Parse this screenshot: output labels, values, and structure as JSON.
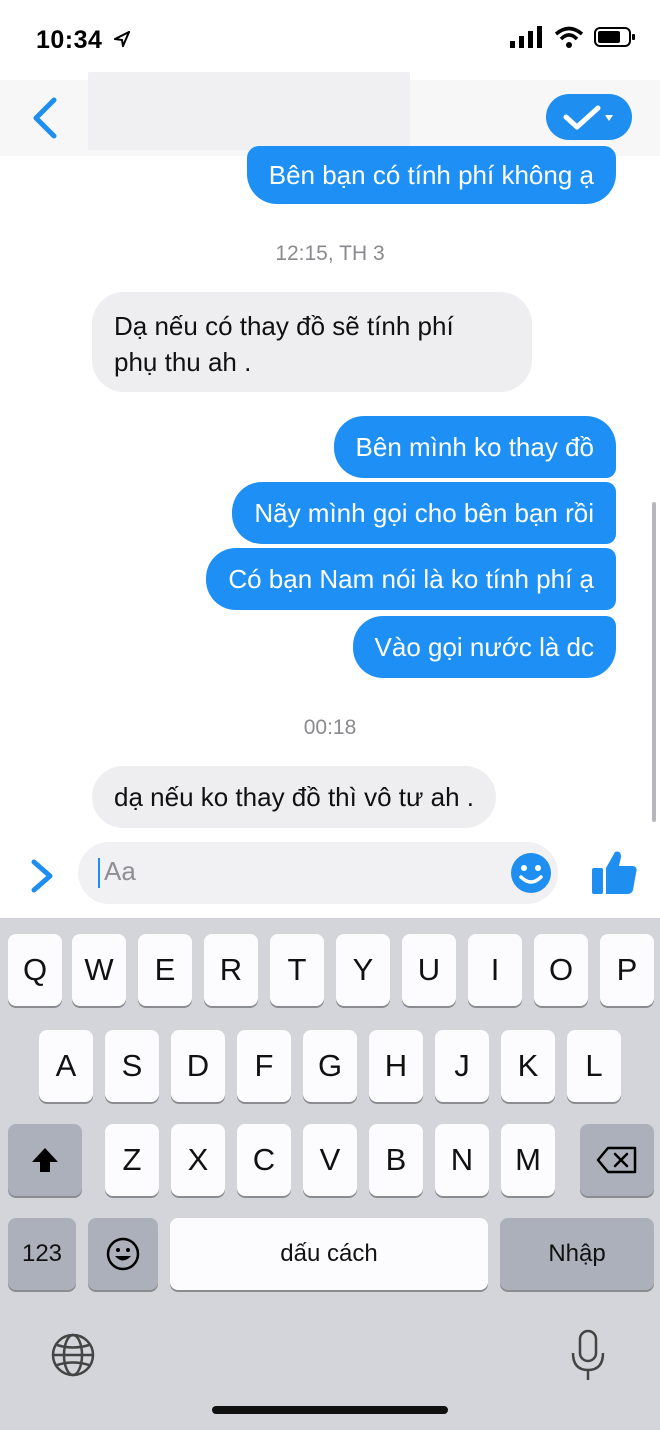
{
  "status": {
    "time": "10:34"
  },
  "header": {
    "back_icon": "chevron-left-icon",
    "action_icon": "check-dropdown-icon",
    "accent": "#1e8ff0"
  },
  "chat": {
    "msg1": "Bên bạn có tính phí không ạ",
    "time1": "12:15, TH 3",
    "msg2_line1": "Dạ nếu có thay đồ sẽ tính phí",
    "msg2_line2": "phụ thu ah .",
    "msg3": "Bên mình ko thay đồ",
    "msg4": "Nãy mình gọi cho bên bạn rồi",
    "msg5": "Có bạn Nam nói là ko tính phí ạ",
    "msg6": "Vào gọi nước là dc",
    "time2": "00:18",
    "msg7": "dạ nếu ko thay đồ thì vô tư ah ."
  },
  "composer": {
    "placeholder": "Aa"
  },
  "keyboard": {
    "row1": [
      "Q",
      "W",
      "E",
      "R",
      "T",
      "Y",
      "U",
      "I",
      "O",
      "P"
    ],
    "row2": [
      "A",
      "S",
      "D",
      "F",
      "G",
      "H",
      "J",
      "K",
      "L"
    ],
    "row3": [
      "Z",
      "X",
      "C",
      "V",
      "B",
      "N",
      "M"
    ],
    "numbers": "123",
    "space": "dấu cách",
    "return": "Nhập"
  }
}
